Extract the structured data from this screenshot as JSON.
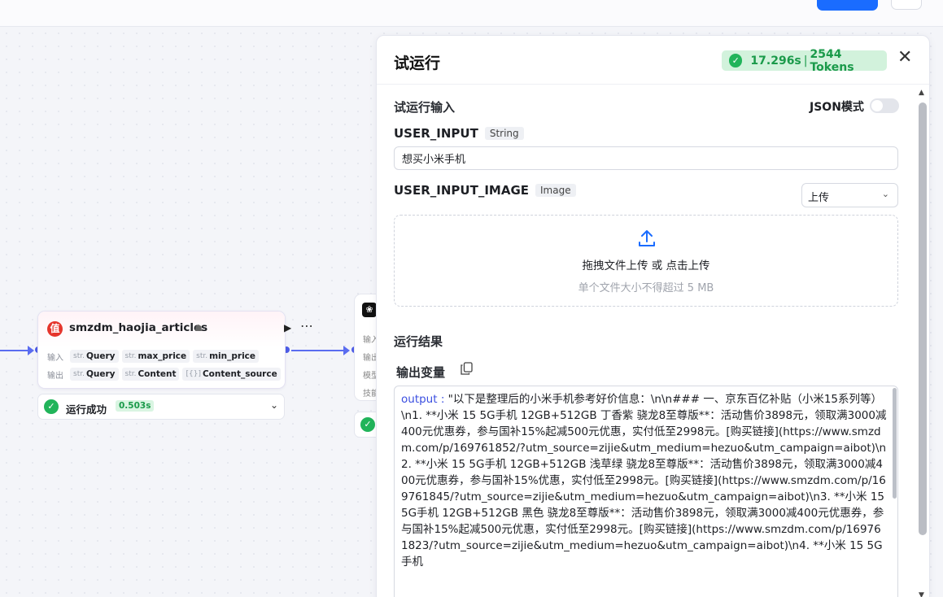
{
  "canvas_node": {
    "logo_text": "值",
    "title": "smzdm_haojia_articles",
    "input_label": "输入",
    "output_label": "输出",
    "inputs": [
      {
        "type": "str.",
        "name": "Query"
      },
      {
        "type": "str.",
        "name": "max_price"
      },
      {
        "type": "str.",
        "name": "min_price"
      }
    ],
    "outputs": [
      {
        "type": "str.",
        "name": "Query"
      },
      {
        "type": "str.",
        "name": "Content"
      },
      {
        "type": "[{}]",
        "name": "Content_source"
      }
    ],
    "status_text": "运行成功",
    "status_time": "0.503s"
  },
  "node2": {
    "labels": [
      "输入",
      "输出",
      "模型",
      "技能"
    ]
  },
  "panel": {
    "title": "试运行",
    "run_time": "17.296s",
    "run_tokens": "2544 Tokens",
    "input_section_title": "试运行输入",
    "json_mode_label": "JSON模式",
    "json_mode_on": false,
    "user_input_label": "USER_INPUT",
    "user_input_type": "String",
    "user_input_value": "想买小米手机",
    "user_input_image_label": "USER_INPUT_IMAGE",
    "user_input_image_type": "Image",
    "upload_mode": "上传",
    "dropzone_title": "拖拽文件上传 或 点击上传",
    "dropzone_sub": "单个文件大小不得超过 5 MB",
    "result_section_title": "运行结果",
    "output_var_title": "输出变量",
    "output_key": "output : ",
    "output_value": "\"以下是整理后的小米手机参考好价信息：\\n\\n### 一、京东百亿补贴（小米15系列等）\\n1. **小米 15 5G手机 12GB+512GB 丁香紫 骁龙8至尊版**：活动售价3898元，领取满3000减400元优惠券，参与国补15%起减500元优惠，实付低至2998元。[购买链接](https://www.smzdm.com/p/169761852/?utm_source=zijie&utm_medium=hezuo&utm_campaign=aibot)\\n2. **小米 15 5G手机 12GB+512GB 浅草绿 骁龙8至尊版**：活动售价3898元，领取满3000减400元优惠券，参与国补15%优惠，实付低至2998元。[购买链接](https://www.smzdm.com/p/169761845/?utm_source=zijie&utm_medium=hezuo&utm_campaign=aibot)\\n3. **小米 15 5G手机 12GB+512GB 黑色 骁龙8至尊版**：活动售价3898元，领取满3000减400元优惠券，参与国补15%起减500元优惠，实付低至2998元。[购买链接](https://www.smzdm.com/p/169761823/?utm_source=zijie&utm_medium=hezuo&utm_campaign=aibot)\\n4. **小米 15 5G手机"
  },
  "colors": {
    "accent": "#1a6cff",
    "success": "#21b45a",
    "edge": "#5a6cf0",
    "output_key": "#3a4ee0"
  }
}
